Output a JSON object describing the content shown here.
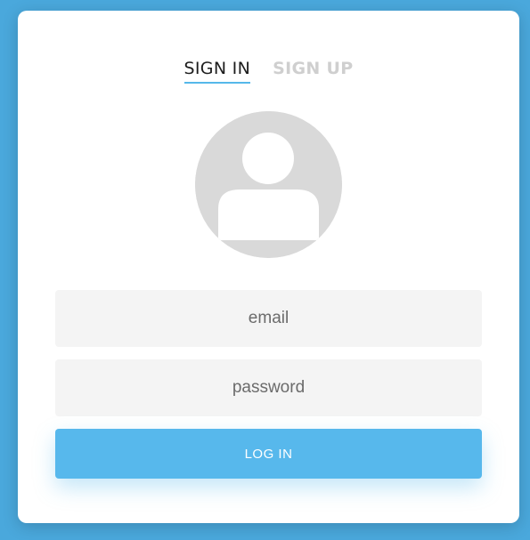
{
  "tabs": {
    "sign_in": "SIGN IN",
    "sign_up": "SIGN UP",
    "active": "sign_in"
  },
  "avatar": {
    "icon": "user-avatar-icon"
  },
  "form": {
    "email_placeholder": "email",
    "email_value": "",
    "password_placeholder": "password",
    "password_value": "",
    "login_label": "LOG IN"
  },
  "colors": {
    "background": "#4aa8dc",
    "accent": "#57b8ec",
    "card": "#ffffff",
    "input_bg": "#f4f4f4",
    "avatar_bg": "#d9d9d9"
  }
}
